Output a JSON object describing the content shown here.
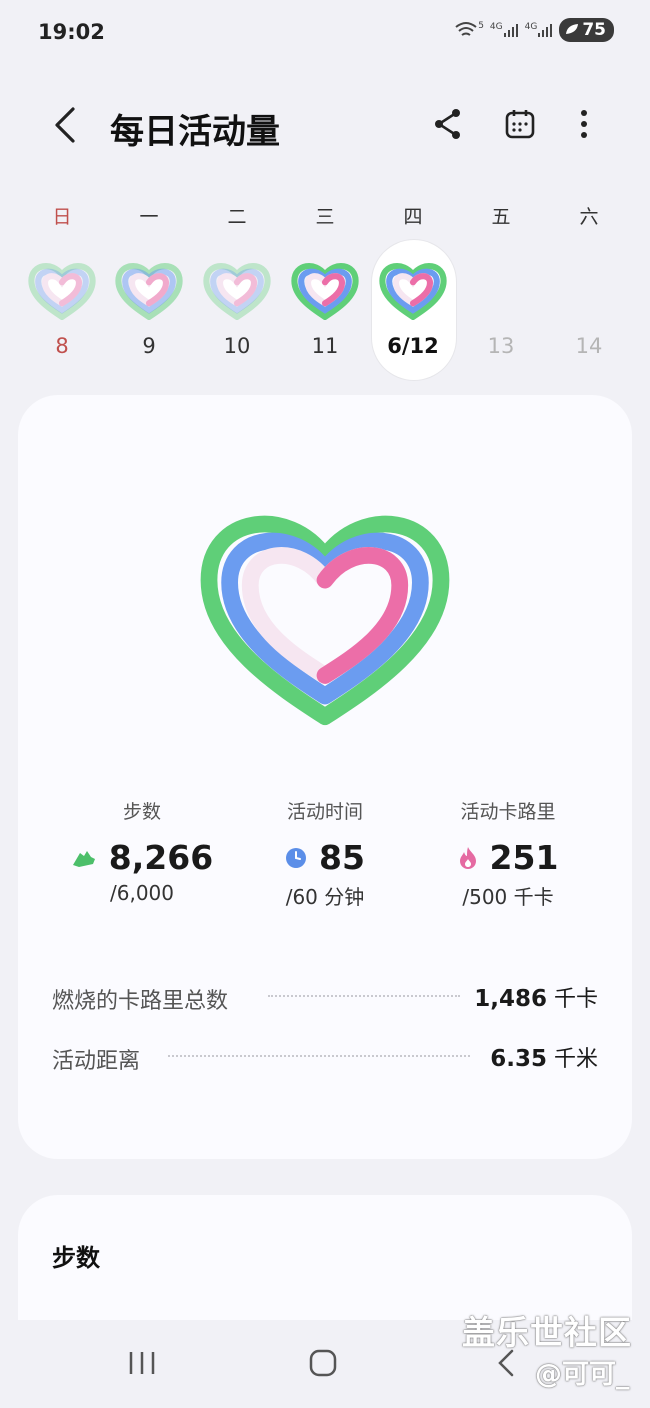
{
  "status_bar": {
    "time": "19:02",
    "battery": "75",
    "net_labels": [
      "5",
      "4G",
      "4G"
    ]
  },
  "header": {
    "title": "每日活动量"
  },
  "week": {
    "days": [
      {
        "weekday": "日",
        "date": "8"
      },
      {
        "weekday": "一",
        "date": "9"
      },
      {
        "weekday": "二",
        "date": "10"
      },
      {
        "weekday": "三",
        "date": "11"
      },
      {
        "weekday": "四",
        "date": "6/12"
      },
      {
        "weekday": "五",
        "date": "13"
      },
      {
        "weekday": "六",
        "date": "14"
      }
    ]
  },
  "summary": {
    "metrics": [
      {
        "label": "步数",
        "value": "8,266",
        "goal": "/6,000",
        "icon": "shoe-icon",
        "color": "#4cbf6a"
      },
      {
        "label": "活动时间",
        "value": "85",
        "goal": "/60 分钟",
        "icon": "clock-icon",
        "color": "#5b8ee8"
      },
      {
        "label": "活动卡路里",
        "value": "251",
        "goal": "/500 千卡",
        "icon": "flame-icon",
        "color": "#e56aa2"
      }
    ],
    "rows": [
      {
        "label": "燃烧的卡路里总数",
        "value": "1,486",
        "unit": "千卡"
      },
      {
        "label": "活动距离",
        "value": "6.35",
        "unit": "千米"
      }
    ]
  },
  "steps_card": {
    "title": "步数"
  },
  "watermark": {
    "line1": "盖乐世社区",
    "line2": "@可可_"
  },
  "colors": {
    "steps": "#5fcf78",
    "active_time": "#6b9cf0",
    "calories": "#ec6ea8",
    "background": "#f1f1f6"
  }
}
